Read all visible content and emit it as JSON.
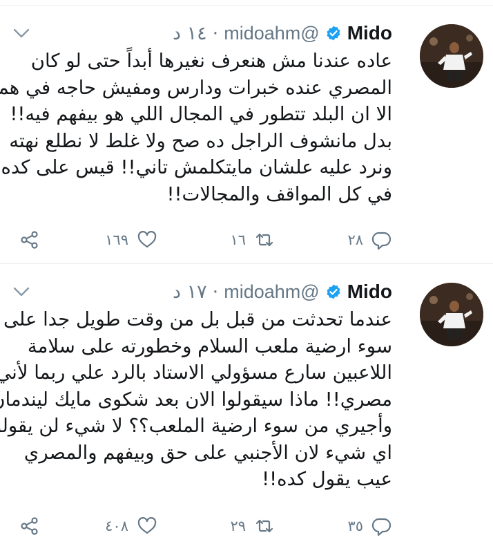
{
  "tweets": [
    {
      "name": "Mido",
      "handle": "@midoahm",
      "time": "١٤ د",
      "lines": [
        "عاده عندنا مش هنعرف نغيرها أبداً حتى لو كان",
        "المصري عنده خبرات ودارس ومفيش حاجه في همه",
        "الا ان البلد تتطور في المجال اللي هو بيفهم فيه!!",
        "بدل مانشوف الراجل ده صح ولا غلط لا نطلع نهته",
        "ونرد عليه علشان مايتكلمش تاني!! قيس على كده",
        "في كل المواقف والمجالات!!"
      ],
      "replies": "٢٨",
      "retweets": "١٦",
      "likes": "١٦٩"
    },
    {
      "name": "Mido",
      "handle": "@midoahm",
      "time": "١٧ د",
      "lines": [
        "عندما تحدثت من قبل بل من وقت طويل جدا على",
        "سوء ارضية ملعب السلام وخطورته على سلامة",
        "اللاعبين سارع مسؤولي الاستاد بالرد علي ربما لأني",
        "مصري!! ماذا سيقولوا الان بعد شكوى مايك ليندمان",
        "وأجيري من سوء ارضية الملعب؟؟ لا شيء لن يقولوا",
        "اي شيء لان الأجنبي على حق وبيفهم والمصري",
        "عيب يقول كده!!"
      ],
      "replies": "٣٥",
      "retweets": "٢٩",
      "likes": "٤٠٨"
    }
  ],
  "icons": {
    "verified": "verified-badge-icon",
    "more": "chevron-down-icon",
    "reply": "reply-icon",
    "retweet": "retweet-icon",
    "like": "heart-icon",
    "share": "share-icon"
  },
  "colors": {
    "text": "#14171a",
    "muted": "#657786",
    "verified": "#1da1f2",
    "divider": "#e6ecf0"
  }
}
